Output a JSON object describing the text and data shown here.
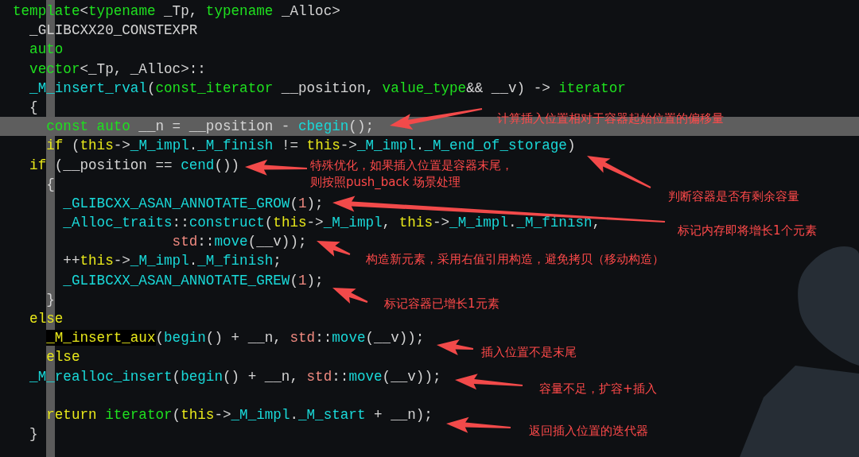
{
  "code_lines": [
    {
      "highlighted": false,
      "tokens": [
        {
          "kind": "type",
          "text": "template"
        },
        {
          "kind": "plain",
          "text": "<"
        },
        {
          "kind": "type",
          "text": "typename"
        },
        {
          "kind": "plain",
          "text": " _Tp, "
        },
        {
          "kind": "type",
          "text": "typename"
        },
        {
          "kind": "plain",
          "text": " _Alloc>"
        }
      ]
    },
    {
      "highlighted": false,
      "tokens": [
        {
          "kind": "plain",
          "text": "  _GLIBCXX20_CONSTEXPR"
        }
      ]
    },
    {
      "highlighted": false,
      "tokens": [
        {
          "kind": "type",
          "text": "  auto"
        }
      ]
    },
    {
      "highlighted": false,
      "tokens": [
        {
          "kind": "type",
          "text": "  vector"
        },
        {
          "kind": "plain",
          "text": "<_Tp, _Alloc>::"
        }
      ]
    },
    {
      "highlighted": false,
      "tokens": [
        {
          "kind": "func",
          "text": "  _M_insert_rval"
        },
        {
          "kind": "plain",
          "text": "("
        },
        {
          "kind": "type",
          "text": "const_iterator"
        },
        {
          "kind": "plain",
          "text": " __position, "
        },
        {
          "kind": "type",
          "text": "value_type"
        },
        {
          "kind": "plain",
          "text": "&& __v) -> "
        },
        {
          "kind": "type",
          "text": "iterator"
        }
      ]
    },
    {
      "highlighted": false,
      "tokens": [
        {
          "kind": "plain",
          "text": "  {"
        }
      ]
    },
    {
      "highlighted": true,
      "tokens": [
        {
          "kind": "type",
          "text": "    const auto"
        },
        {
          "kind": "plain",
          "text": " __n = __position - "
        },
        {
          "kind": "func",
          "text": "cbegin"
        },
        {
          "kind": "plain",
          "text": "();"
        }
      ]
    },
    {
      "highlighted": false,
      "tokens": [
        {
          "kind": "keyword",
          "text": "    if"
        },
        {
          "kind": "plain",
          "text": " ("
        },
        {
          "kind": "keyword",
          "text": "this"
        },
        {
          "kind": "plain",
          "text": "->"
        },
        {
          "kind": "func",
          "text": "_M_impl"
        },
        {
          "kind": "plain",
          "text": "."
        },
        {
          "kind": "func",
          "text": "_M_finish"
        },
        {
          "kind": "plain",
          "text": " != "
        },
        {
          "kind": "keyword",
          "text": "this"
        },
        {
          "kind": "plain",
          "text": "->"
        },
        {
          "kind": "func",
          "text": "_M_impl"
        },
        {
          "kind": "plain",
          "text": "."
        },
        {
          "kind": "func",
          "text": "_M_end_of_storage"
        },
        {
          "kind": "plain",
          "text": ")"
        }
      ]
    },
    {
      "highlighted": false,
      "tokens": [
        {
          "kind": "keyword",
          "text": "  if"
        },
        {
          "kind": "plain",
          "text": " (__position == "
        },
        {
          "kind": "func",
          "text": "cend"
        },
        {
          "kind": "plain",
          "text": "())"
        }
      ]
    },
    {
      "highlighted": false,
      "tokens": [
        {
          "kind": "plain",
          "text": "    {"
        }
      ]
    },
    {
      "highlighted": false,
      "tokens": [
        {
          "kind": "func",
          "text": "      _GLIBCXX_ASAN_ANNOTATE_GROW"
        },
        {
          "kind": "plain",
          "text": "("
        },
        {
          "kind": "literal",
          "text": "1"
        },
        {
          "kind": "plain",
          "text": ");"
        }
      ]
    },
    {
      "highlighted": false,
      "tokens": [
        {
          "kind": "func",
          "text": "      _Alloc_traits"
        },
        {
          "kind": "plain",
          "text": "::"
        },
        {
          "kind": "func",
          "text": "construct"
        },
        {
          "kind": "plain",
          "text": "("
        },
        {
          "kind": "keyword",
          "text": "this"
        },
        {
          "kind": "plain",
          "text": "->"
        },
        {
          "kind": "func",
          "text": "_M_impl"
        },
        {
          "kind": "plain",
          "text": ", "
        },
        {
          "kind": "keyword",
          "text": "this"
        },
        {
          "kind": "plain",
          "text": "->"
        },
        {
          "kind": "func",
          "text": "_M_impl"
        },
        {
          "kind": "plain",
          "text": "."
        },
        {
          "kind": "func",
          "text": "_M_finish"
        },
        {
          "kind": "plain",
          "text": ","
        }
      ]
    },
    {
      "highlighted": false,
      "tokens": [
        {
          "kind": "literal",
          "text": "                   std"
        },
        {
          "kind": "plain",
          "text": "::"
        },
        {
          "kind": "func",
          "text": "move"
        },
        {
          "kind": "plain",
          "text": "(__v));"
        }
      ]
    },
    {
      "highlighted": false,
      "tokens": [
        {
          "kind": "plain",
          "text": "      ++"
        },
        {
          "kind": "keyword",
          "text": "this"
        },
        {
          "kind": "plain",
          "text": "->"
        },
        {
          "kind": "func",
          "text": "_M_impl"
        },
        {
          "kind": "plain",
          "text": "."
        },
        {
          "kind": "func",
          "text": "_M_finish"
        },
        {
          "kind": "plain",
          "text": ";"
        }
      ]
    },
    {
      "highlighted": false,
      "tokens": [
        {
          "kind": "func",
          "text": "      _GLIBCXX_ASAN_ANNOTATE_GREW"
        },
        {
          "kind": "plain",
          "text": "("
        },
        {
          "kind": "literal",
          "text": "1"
        },
        {
          "kind": "plain",
          "text": ");"
        }
      ]
    },
    {
      "highlighted": false,
      "tokens": [
        {
          "kind": "plain",
          "text": "    }"
        }
      ]
    },
    {
      "highlighted": false,
      "tokens": [
        {
          "kind": "keyword",
          "text": "  else"
        }
      ]
    },
    {
      "highlighted": false,
      "tokens": [
        {
          "kind": "match",
          "text": "    _M_insert_aux"
        },
        {
          "kind": "plain",
          "text": "("
        },
        {
          "kind": "func",
          "text": "begin"
        },
        {
          "kind": "plain",
          "text": "() + __n, "
        },
        {
          "kind": "literal",
          "text": "std"
        },
        {
          "kind": "plain",
          "text": "::"
        },
        {
          "kind": "func",
          "text": "move"
        },
        {
          "kind": "plain",
          "text": "(__v));"
        }
      ]
    },
    {
      "highlighted": false,
      "tokens": [
        {
          "kind": "keyword",
          "text": "    else"
        }
      ]
    },
    {
      "highlighted": false,
      "tokens": [
        {
          "kind": "func",
          "text": "  _M_realloc_insert"
        },
        {
          "kind": "plain",
          "text": "("
        },
        {
          "kind": "func",
          "text": "begin"
        },
        {
          "kind": "plain",
          "text": "() + __n, "
        },
        {
          "kind": "literal",
          "text": "std"
        },
        {
          "kind": "plain",
          "text": "::"
        },
        {
          "kind": "func",
          "text": "move"
        },
        {
          "kind": "plain",
          "text": "(__v));"
        }
      ]
    },
    {
      "highlighted": false
    },
    {
      "highlighted": false,
      "tokens": [
        {
          "kind": "keyword",
          "text": "    return "
        },
        {
          "kind": "type",
          "text": "iterator"
        },
        {
          "kind": "plain",
          "text": "("
        },
        {
          "kind": "keyword",
          "text": "this"
        },
        {
          "kind": "plain",
          "text": "->"
        },
        {
          "kind": "func",
          "text": "_M_impl"
        },
        {
          "kind": "plain",
          "text": "."
        },
        {
          "kind": "func",
          "text": "_M_start"
        },
        {
          "kind": "plain",
          "text": " + __n);"
        }
      ]
    },
    {
      "highlighted": false,
      "tokens": [
        {
          "kind": "plain",
          "text": "  }"
        }
      ]
    }
  ],
  "annotations": [
    {
      "lines": [
        "计算插入位置相对于容器起始位置的偏移量"
      ]
    },
    {
      "lines": [
        "特殊优化，如果插入位置是容器末尾，",
        "则按照push_back 场景处理"
      ]
    },
    {
      "lines": [
        "判断容器是否有剩余容量"
      ]
    },
    {
      "lines": [
        "标记内存即将增长1个元素"
      ]
    },
    {
      "lines": [
        "构造新元素，采用右值引用构造，避免拷贝（移动构造）"
      ]
    },
    {
      "lines": [
        "标记容器已增长1元素"
      ]
    },
    {
      "lines": [
        "插入位置不是末尾"
      ]
    },
    {
      "lines": [
        "容量不足，扩容+插入"
      ]
    },
    {
      "lines": [
        "返回插入位置的迭代器"
      ]
    }
  ]
}
